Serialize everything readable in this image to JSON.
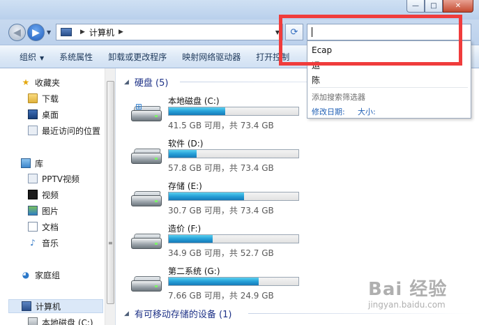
{
  "window": {
    "minimize_glyph": "—",
    "maximize_glyph": "□",
    "close_glyph": "✕"
  },
  "address_bar": {
    "crumbs": [
      "计算机"
    ],
    "search_value": ""
  },
  "toolbar": {
    "items": [
      "组织",
      "系统属性",
      "卸载或更改程序",
      "映射网络驱动器",
      "打开控制"
    ]
  },
  "nav_pane": {
    "favorites": {
      "label": "收藏夹",
      "items": [
        "下载",
        "桌面",
        "最近访问的位置"
      ]
    },
    "libraries": {
      "label": "库",
      "items": [
        "PPTV视频",
        "视频",
        "图片",
        "文档",
        "音乐"
      ]
    },
    "homegroup": {
      "label": "家庭组"
    },
    "computer": {
      "label": "计算机",
      "items": [
        "本地磁盘 (C:)"
      ]
    }
  },
  "content": {
    "hard_disks_header": "硬盘 (5)",
    "removable_header": "有可移动存储的设备 (1)",
    "drives": [
      {
        "name": "本地磁盘 (C:)",
        "info": "41.5 GB 可用，共 73.4 GB",
        "used_fraction": 0.435,
        "icon": "windows-drive-icon"
      },
      {
        "name": "软件 (D:)",
        "info": "57.8 GB 可用，共 73.4 GB",
        "used_fraction": 0.213,
        "icon": "hard-drive-icon"
      },
      {
        "name": "存储 (E:)",
        "info": "30.7 GB 可用，共 73.4 GB",
        "used_fraction": 0.582,
        "icon": "hard-drive-icon"
      },
      {
        "name": "造价 (F:)",
        "info": "34.9 GB 可用，共 52.7 GB",
        "used_fraction": 0.338,
        "icon": "hard-drive-icon"
      },
      {
        "name": "第二系统 (G:)",
        "info": "7.66 GB 可用，共 24.9 GB",
        "used_fraction": 0.692,
        "icon": "hard-drive-icon"
      }
    ]
  },
  "search_suggestions": {
    "items": [
      "Ecap",
      "运",
      "陈"
    ],
    "filter_title": "添加搜索筛选器",
    "filters": [
      "修改日期:",
      "大小:"
    ]
  },
  "watermark": {
    "logo": "Bai 经验",
    "sub": "jingyan.baidu.com"
  },
  "colors": {
    "highlight": "#f03c3c",
    "group_header": "#1e3287",
    "drive_fill": "#26a0d8"
  }
}
